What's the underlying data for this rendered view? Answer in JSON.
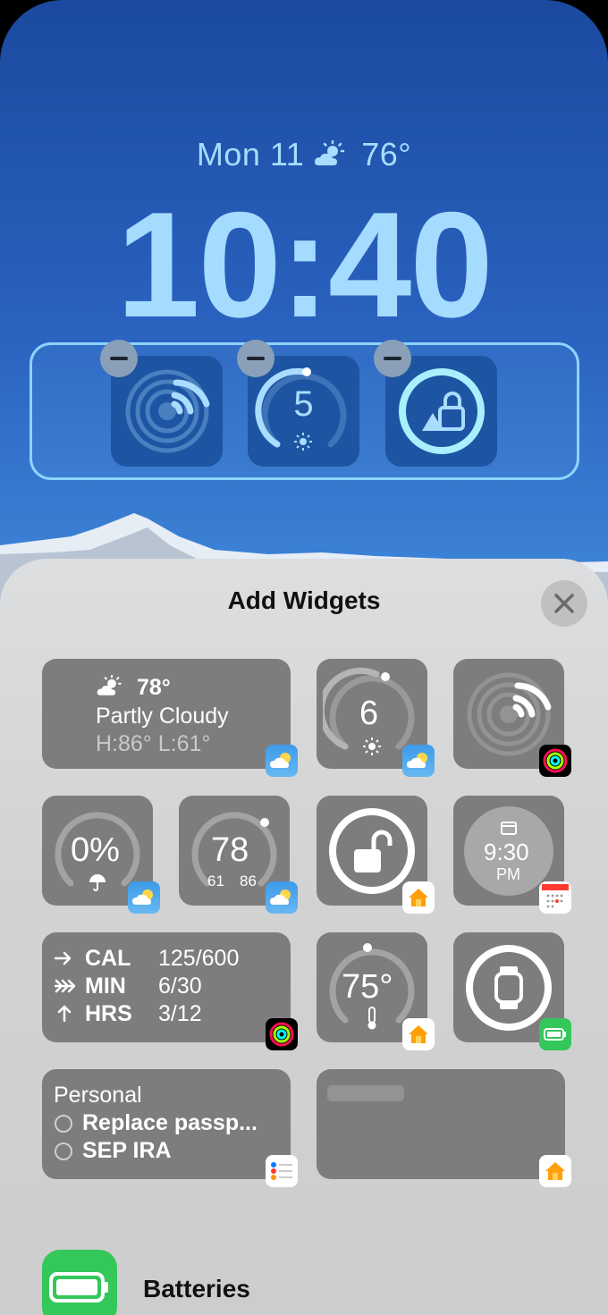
{
  "lock_screen": {
    "date": "Mon 11",
    "temp": "76°",
    "time": "10:40",
    "widgets": [
      {
        "name": "activity-rings-widget",
        "icon": "wifi-rings-icon"
      },
      {
        "name": "uv-index-widget",
        "value": "5"
      },
      {
        "name": "home-lock-widget",
        "icon": "lock-icon"
      }
    ]
  },
  "sheet": {
    "title": "Add Widgets",
    "close_icon": "close-icon",
    "weather_widget": {
      "temp": "78°",
      "condition": "Partly Cloudy",
      "hilo": "H:86° L:61°"
    },
    "uv_widget": {
      "value": "6"
    },
    "rain_widget": {
      "value": "0%"
    },
    "temp_gauge_widget": {
      "value": "78",
      "low": "61",
      "high": "86"
    },
    "calendar_widget": {
      "time": "9:30",
      "ampm": "PM"
    },
    "activity_widget": {
      "rows": [
        {
          "label": "CAL",
          "value": "125/600"
        },
        {
          "label": "MIN",
          "value": "6/30"
        },
        {
          "label": "HRS",
          "value": "3/12"
        }
      ]
    },
    "thermostat_widget": {
      "value": "75°"
    },
    "reminders_widget": {
      "title": "Personal",
      "items": [
        "Replace passp...",
        "SEP IRA"
      ]
    },
    "apps": [
      {
        "label": "Batteries",
        "icon": "battery-icon"
      }
    ]
  },
  "colors": {
    "lock_text": "#a4dbff",
    "widget_bg": "#7d7d7d",
    "sheet_bg": "#d3d3d3",
    "frame": "#8dd4ff"
  }
}
